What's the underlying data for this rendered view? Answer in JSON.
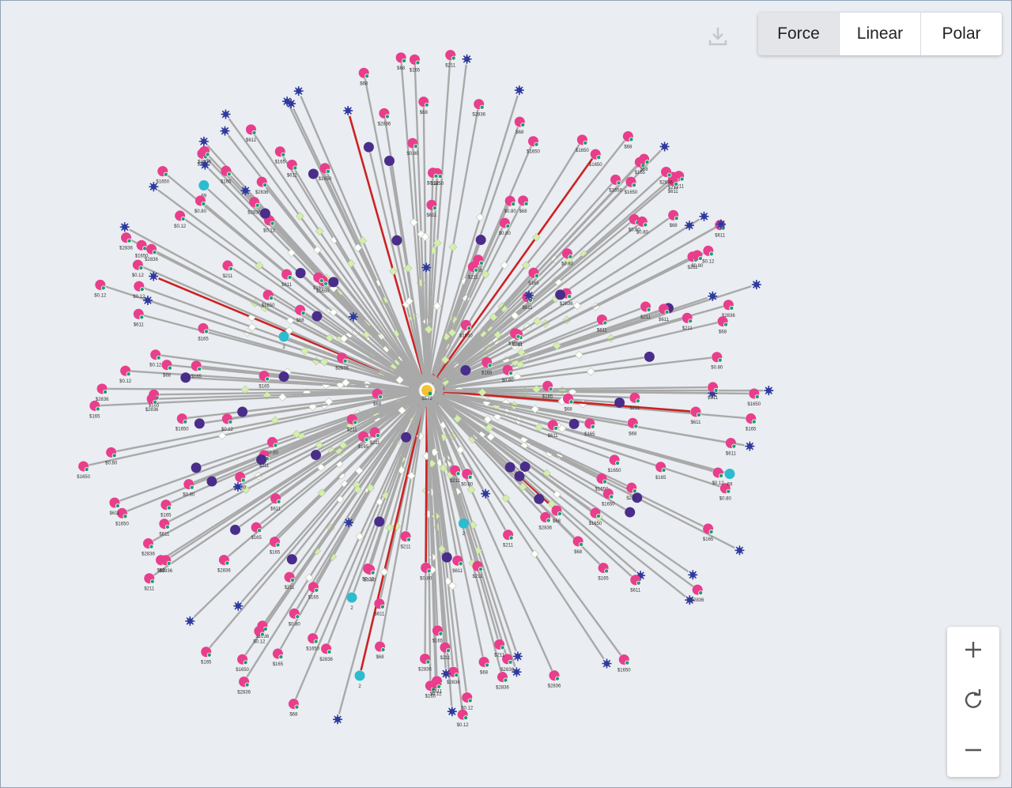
{
  "toolbar": {
    "download_icon": "download-icon",
    "layouts": [
      {
        "label": "Force",
        "active": true
      },
      {
        "label": "Linear",
        "active": false
      },
      {
        "label": "Polar",
        "active": false
      }
    ]
  },
  "zoom": {
    "zoom_in_icon": "plus-icon",
    "reset_icon": "refresh-icon",
    "zoom_out_icon": "minus-icon"
  },
  "graph": {
    "center_label": "$572",
    "colors": {
      "background": "#eaedf1",
      "edge": "#a9a9a9",
      "highlight_edge": "#cc2222",
      "pink_node": "#e83e8c",
      "purple_node": "#4a2d8a",
      "teal_node": "#2bbcd0",
      "star_node": "#2e3a9e",
      "center_node": "#f6c232",
      "status_dot": "#1e9e6a",
      "green_diamond": "#d4f0a8",
      "white_diamond": "#ffffff"
    },
    "label_values": [
      "$211",
      "$2836",
      "$165",
      "$611",
      "$0.80",
      "$0.12",
      "$1650",
      "$68",
      "2",
      "7",
      "69"
    ],
    "legend_node_types": [
      "pink-node",
      "purple-node",
      "teal-node",
      "star-node",
      "center-node"
    ]
  }
}
